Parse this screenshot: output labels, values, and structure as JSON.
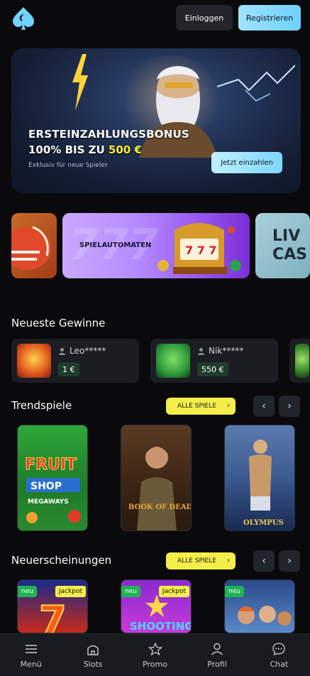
{
  "header": {
    "login_label": "Einloggen",
    "register_label": "Registrieren"
  },
  "hero": {
    "title_line1": "ERSTEINZAHLUNGSBONUS",
    "title_line2_prefix": "100% BIS ZU",
    "title_line2_highlight": "500 €",
    "subtitle": "Exklusiv für neue Spieler",
    "cta_label": "Jetzt einzahlen"
  },
  "categories": {
    "slots_label": "SPIELAUTOMATEN",
    "live_label_1": "LIV",
    "live_label_2": "CAS"
  },
  "latest_wins": {
    "title": "Neueste Gewinne",
    "items": [
      {
        "user": "Leo*****",
        "amount": "1 €"
      },
      {
        "user": "Nik*****",
        "amount": "550 €"
      }
    ]
  },
  "trending": {
    "title": "Trendspiele",
    "all_games_label": "ALLE SPIELE"
  },
  "new_releases": {
    "title": "Neuerscheinungen",
    "all_games_label": "ALLE SPIELE",
    "badge_new": "neu",
    "badge_jackpot": "Jackpot"
  },
  "bottom_nav": {
    "menu": "Menü",
    "slots": "Slots",
    "promo": "Promo",
    "profile": "Profil",
    "chat": "Chat"
  },
  "colors": {
    "accent_yellow": "#f4ee4a",
    "accent_cyan": "#7fd6ff",
    "win_badge": "#1f3d2c",
    "new_badge": "#1eb455"
  }
}
